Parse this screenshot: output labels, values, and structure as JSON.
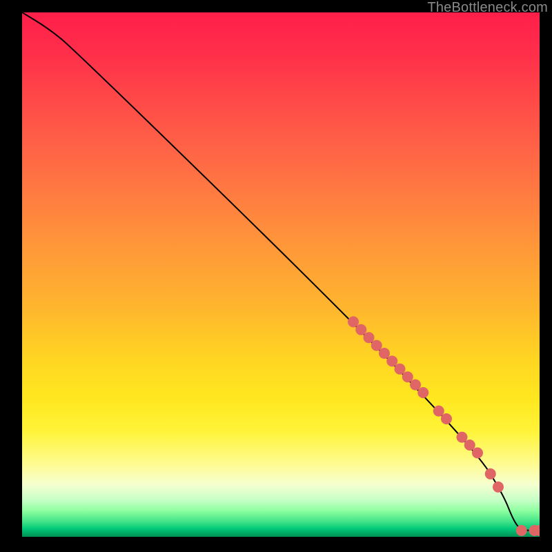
{
  "watermark": "TheBottleneck.com",
  "chart_data": {
    "type": "line",
    "title": "",
    "xlabel": "",
    "ylabel": "",
    "x_range": [
      0,
      100
    ],
    "y_range": [
      0,
      100
    ],
    "curve": {
      "name": "bottleneck-curve",
      "points": [
        {
          "x": 0,
          "y": 100
        },
        {
          "x": 5,
          "y": 97
        },
        {
          "x": 10,
          "y": 93
        },
        {
          "x": 64,
          "y": 41
        },
        {
          "x": 88,
          "y": 16
        },
        {
          "x": 93,
          "y": 8
        },
        {
          "x": 95,
          "y": 3
        },
        {
          "x": 96.5,
          "y": 1.2
        },
        {
          "x": 100,
          "y": 1.2
        }
      ]
    },
    "markers": {
      "name": "highlight-dots",
      "color": "#e06666",
      "radius_px": 8,
      "points": [
        {
          "x": 64.0,
          "y": 41.0
        },
        {
          "x": 65.5,
          "y": 39.5
        },
        {
          "x": 67.0,
          "y": 38.0
        },
        {
          "x": 68.5,
          "y": 36.5
        },
        {
          "x": 70.0,
          "y": 35.0
        },
        {
          "x": 71.5,
          "y": 33.5
        },
        {
          "x": 73.0,
          "y": 32.0
        },
        {
          "x": 74.5,
          "y": 30.5
        },
        {
          "x": 76.0,
          "y": 29.0
        },
        {
          "x": 77.5,
          "y": 27.5
        },
        {
          "x": 80.5,
          "y": 24.0
        },
        {
          "x": 82.0,
          "y": 22.5
        },
        {
          "x": 85.0,
          "y": 19.0
        },
        {
          "x": 86.5,
          "y": 17.5
        },
        {
          "x": 88.0,
          "y": 16.0
        },
        {
          "x": 90.5,
          "y": 12.0
        },
        {
          "x": 92.0,
          "y": 9.5
        },
        {
          "x": 96.5,
          "y": 1.2
        },
        {
          "x": 99.0,
          "y": 1.2
        },
        {
          "x": 100.0,
          "y": 1.2
        }
      ]
    },
    "background": {
      "type": "vertical-gradient",
      "stops": [
        {
          "pos": 0.0,
          "color": "#ff1f4a"
        },
        {
          "pos": 0.5,
          "color": "#ffb52e"
        },
        {
          "pos": 0.8,
          "color": "#fff43a"
        },
        {
          "pos": 0.93,
          "color": "#c6ffc6"
        },
        {
          "pos": 1.0,
          "color": "#008f54"
        }
      ]
    }
  }
}
